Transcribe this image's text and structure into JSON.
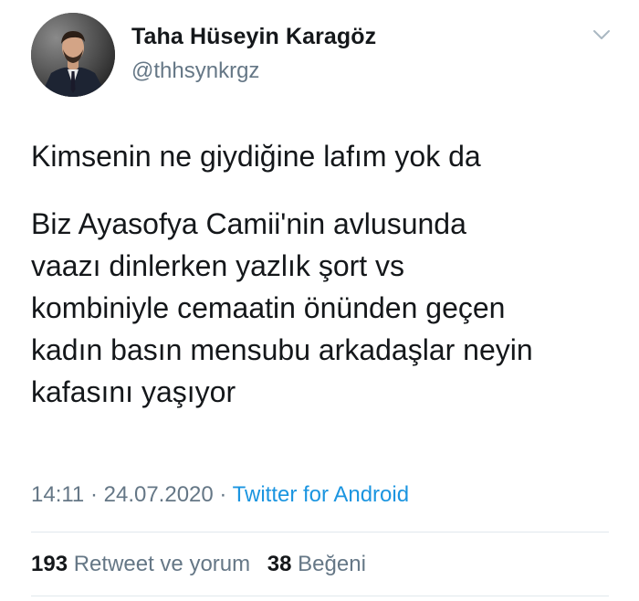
{
  "user": {
    "display_name": "Taha Hüseyin Karagöz",
    "handle": "@thhsynkrgz",
    "avatar_icon": "profile-photo"
  },
  "tweet": {
    "paragraphs": [
      [
        "Kimsenin ne giydiğine lafım yok da"
      ],
      [
        "Biz Ayasofya Camii'nin avlusunda",
        "vaazı dinlerken yazlık şort vs",
        "kombiniyle cemaatin önünden geçen",
        "kadın basın mensubu arkadaşlar neyin",
        "kafasını yaşıyor"
      ]
    ]
  },
  "meta": {
    "time": "14:11",
    "separator": "·",
    "date": "24.07.2020",
    "source": "Twitter for Android"
  },
  "stats": {
    "retweets_count": "193",
    "retweets_label": "Retweet ve yorum",
    "likes_count": "38",
    "likes_label": "Beğeni"
  },
  "colors": {
    "text": "#14171a",
    "secondary": "#657786",
    "link": "#1b95e0",
    "divider": "#e1e8ed"
  }
}
